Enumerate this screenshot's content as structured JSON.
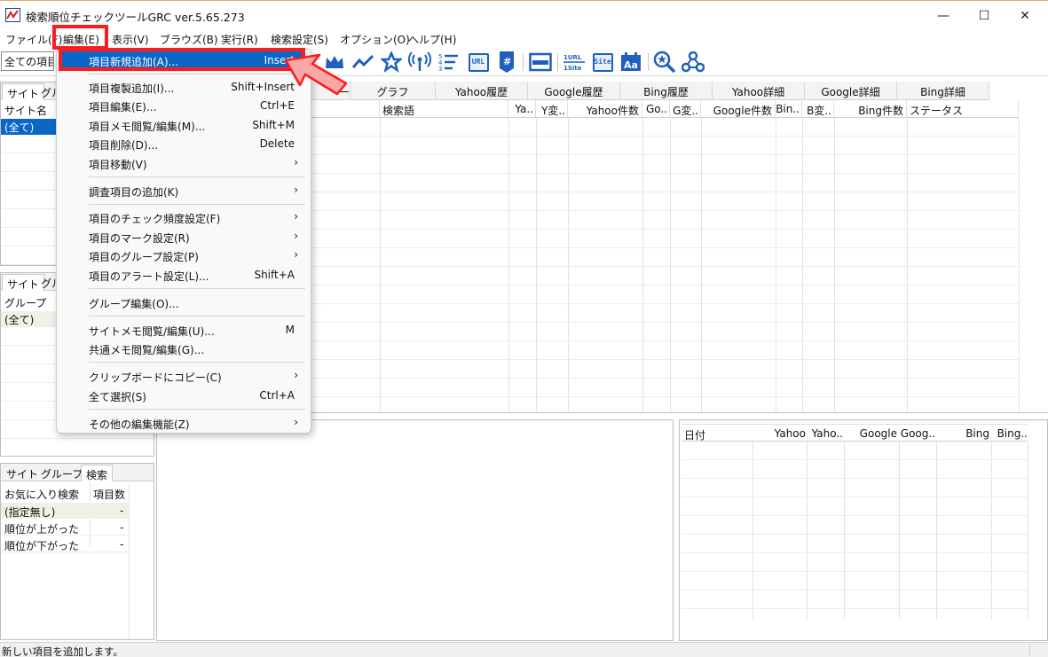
{
  "window": {
    "title": "検索順位チェックツールGRC  ver.5.65.273",
    "minimize": "—",
    "maximize": "☐",
    "close": "✕"
  },
  "menubar": [
    {
      "label": "ファイル(F)"
    },
    {
      "label": "編集(E)"
    },
    {
      "label": "表示(V)"
    },
    {
      "label": "ブラウズ(B)"
    },
    {
      "label": "実行(R)"
    },
    {
      "label": "検索設定(S)"
    },
    {
      "label": "オプション(O)"
    },
    {
      "label": "ヘルプ(H)"
    }
  ],
  "toolbar": {
    "filter_value": "全ての項目",
    "icons": [
      "crown-icon",
      "trend-line-icon",
      "star-icon",
      "signal-icon",
      "ranking-list-icon",
      "url-icon",
      "hashtag-icon",
      "window-icon",
      "1url-1site-icon",
      "site-icon",
      "font-calendar-icon",
      "search-star-icon",
      "network-icon"
    ],
    "labels": {
      "ranking": "5\n4\n3",
      "url": "URL",
      "hash": "#",
      "oneurl": "1URL\n1Site",
      "site": "Site",
      "aa": "Aa"
    }
  },
  "left_top": {
    "tabs": [
      "サイト",
      "グル"
    ],
    "header": "サイト名",
    "selected_row": "(全て)"
  },
  "left_middle": {
    "tabs": [
      "サイト",
      "グル"
    ],
    "header": "グループ",
    "selected_row": "(全て)"
  },
  "left_bottom": {
    "tabs": [
      "サイト",
      "グループ",
      "検索"
    ],
    "headers": [
      "お気に入り検索",
      "項目数"
    ],
    "rows": [
      {
        "name": "(指定無し)",
        "count": "-"
      },
      {
        "name": "順位が上がった",
        "count": "-"
      },
      {
        "name": "順位が下がった",
        "count": "-"
      }
    ]
  },
  "main_grid": {
    "tabs": [
      "ー",
      "グラフ",
      "Yahoo履歴",
      "Google履歴",
      "Bing履歴",
      "Yahoo詳細",
      "Google詳細",
      "Bing詳細"
    ],
    "columns": [
      "検索語",
      "Ya..",
      "Y変..",
      "Yahoo件数",
      "Go..",
      "G変..",
      "Google件数",
      "Bin..",
      "B変..",
      "Bing件数",
      "ステータス"
    ]
  },
  "history_panel": {
    "columns": [
      "日付",
      "Yahoo",
      "Yaho..",
      "Google",
      "Goog..",
      "Bing",
      "Bing.."
    ]
  },
  "edit_menu": {
    "items": [
      {
        "label": "項目新規追加(A)...",
        "shortcut": "Insert",
        "highlighted": true
      },
      {
        "separator": true
      },
      {
        "label": "項目複製追加(I)...",
        "shortcut": "Shift+Insert"
      },
      {
        "label": "項目編集(E)...",
        "shortcut": "Ctrl+E"
      },
      {
        "label": "項目メモ閲覧/編集(M)...",
        "shortcut": "Shift+M"
      },
      {
        "label": "項目削除(D)...",
        "shortcut": "Delete"
      },
      {
        "label": "項目移動(V)",
        "submenu": true
      },
      {
        "separator": true
      },
      {
        "label": "調査項目の追加(K)",
        "submenu": true
      },
      {
        "separator": true
      },
      {
        "label": "項目のチェック頻度設定(F)",
        "submenu": true
      },
      {
        "label": "項目のマーク設定(R)",
        "submenu": true
      },
      {
        "label": "項目のグループ設定(P)",
        "submenu": true
      },
      {
        "label": "項目のアラート設定(L)...",
        "shortcut": "Shift+A"
      },
      {
        "separator": true
      },
      {
        "label": "グループ編集(O)..."
      },
      {
        "separator": true
      },
      {
        "label": "サイトメモ閲覧/編集(U)...",
        "shortcut": "M"
      },
      {
        "label": "共通メモ閲覧/編集(G)..."
      },
      {
        "separator": true
      },
      {
        "label": "クリップボードにコピー(C)",
        "submenu": true
      },
      {
        "label": "全て選択(S)",
        "shortcut": "Ctrl+A"
      },
      {
        "separator": true
      },
      {
        "label": "その他の編集機能(Z)",
        "submenu": true
      }
    ],
    "submenu_arrow": "›"
  },
  "statusbar": {
    "text": "新しい項目を追加します。"
  },
  "colors": {
    "highlight": "#0a67c6",
    "annotation_red": "#ff1b1b",
    "arrow_fill": "#f9a7a7",
    "icon_blue": "#1f5fbf",
    "selected_row": "#0a67c6",
    "filter_row": "#f2efe6"
  }
}
